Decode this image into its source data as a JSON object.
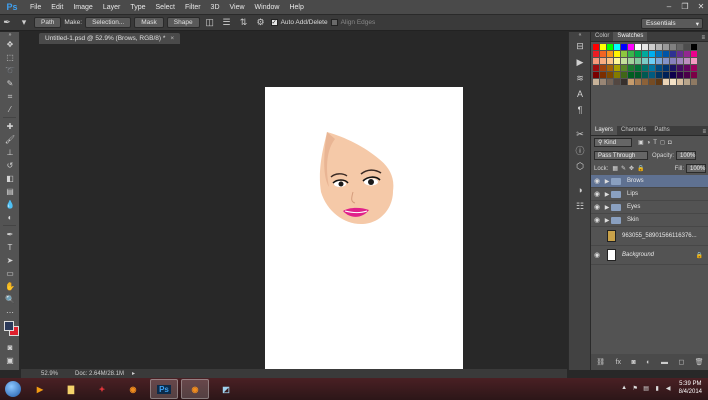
{
  "menubar": {
    "logo": "Ps",
    "items": [
      "File",
      "Edit",
      "Image",
      "Layer",
      "Type",
      "Select",
      "Filter",
      "3D",
      "View",
      "Window",
      "Help"
    ],
    "window_controls": [
      "–",
      "❐",
      "✕"
    ]
  },
  "options": {
    "path_mode": "Path",
    "make_label": "Make:",
    "selection_btn": "Selection...",
    "mask_btn": "Mask",
    "shape_btn": "Shape",
    "auto_add_delete": "Auto Add/Delete",
    "align_edges": "Align Edges",
    "workspace": "Essentials"
  },
  "document": {
    "tab_title": "Untitled-1.psd @ 52.9% (Brows, RGB/8) *",
    "zoom": "52.9%",
    "doc_size": "Doc: 2.64M/28.1M"
  },
  "colors": {
    "foreground": "#2c3a5a",
    "background": "#e0212e",
    "selection": "#5f7191",
    "lips": "#e0218a",
    "skin": "#f5c9a8"
  },
  "color_panel": {
    "tabs": [
      "Color",
      "Swatches"
    ],
    "active_tab": "Swatches",
    "swatches": [
      "#ff0000",
      "#ffff00",
      "#00ff00",
      "#00ffff",
      "#0000ff",
      "#ff00ff",
      "#ffffff",
      "#e6e6e6",
      "#cccccc",
      "#b3b3b3",
      "#999999",
      "#808080",
      "#666666",
      "#4d4d4d",
      "#000000",
      "#ed1c24",
      "#f26522",
      "#f7941d",
      "#fff200",
      "#8dc63f",
      "#39b54a",
      "#00a651",
      "#00a99d",
      "#00aeef",
      "#0072bc",
      "#0054a6",
      "#2e3192",
      "#662d91",
      "#92278f",
      "#ec008c",
      "#f7977a",
      "#f9ad81",
      "#fdc68a",
      "#fff79a",
      "#c4df9b",
      "#a3d39c",
      "#82ca9d",
      "#7accc8",
      "#6dcff6",
      "#7da7d9",
      "#8393ca",
      "#8781bd",
      "#a186be",
      "#bd8cbf",
      "#f49ac1",
      "#9e0b0f",
      "#a0410d",
      "#a36209",
      "#aba000",
      "#598527",
      "#1a7b30",
      "#007236",
      "#00746b",
      "#0076a3",
      "#004b80",
      "#003471",
      "#1b1464",
      "#440e62",
      "#630460",
      "#9e005d",
      "#790000",
      "#7b2e00",
      "#7d4900",
      "#827b00",
      "#406618",
      "#005e20",
      "#005826",
      "#005952",
      "#005b7f",
      "#003663",
      "#002157",
      "#0d004c",
      "#32004b",
      "#4b0049",
      "#7b0046",
      "#c7b299",
      "#998675",
      "#736357",
      "#534741",
      "#37302d",
      "#c69c6d",
      "#a67c52",
      "#8c6239",
      "#754c24",
      "#603913",
      "#ebd4b5",
      "#f3e1c6",
      "#d9bfa0",
      "#b8a58b",
      "#8f7a63"
    ]
  },
  "layers_panel": {
    "tabs": [
      "Layers",
      "Channels",
      "Paths"
    ],
    "active_tab": "Layers",
    "filter_kind": "Kind",
    "blend_mode": "Pass Through",
    "opacity_label": "Opacity:",
    "opacity": "100%",
    "lock_label": "Lock:",
    "fill_label": "Fill:",
    "fill": "100%",
    "layers": [
      {
        "name": "Brows",
        "type": "group",
        "visible": true,
        "selected": true
      },
      {
        "name": "Lips",
        "type": "group",
        "visible": true,
        "selected": false
      },
      {
        "name": "Eyes",
        "type": "group",
        "visible": true,
        "selected": false
      },
      {
        "name": "Skin",
        "type": "group",
        "visible": true,
        "selected": false
      },
      {
        "name": "963055_58901566116376...",
        "type": "image",
        "visible": false,
        "selected": false
      },
      {
        "name": "Background",
        "type": "background",
        "visible": true,
        "selected": false
      }
    ]
  },
  "taskbar": {
    "apps": [
      "media-player",
      "explorer",
      "game",
      "firefox",
      "photoshop",
      "firefox",
      "app"
    ],
    "clock_time": "5:39 PM",
    "clock_date": "8/4/2014"
  }
}
